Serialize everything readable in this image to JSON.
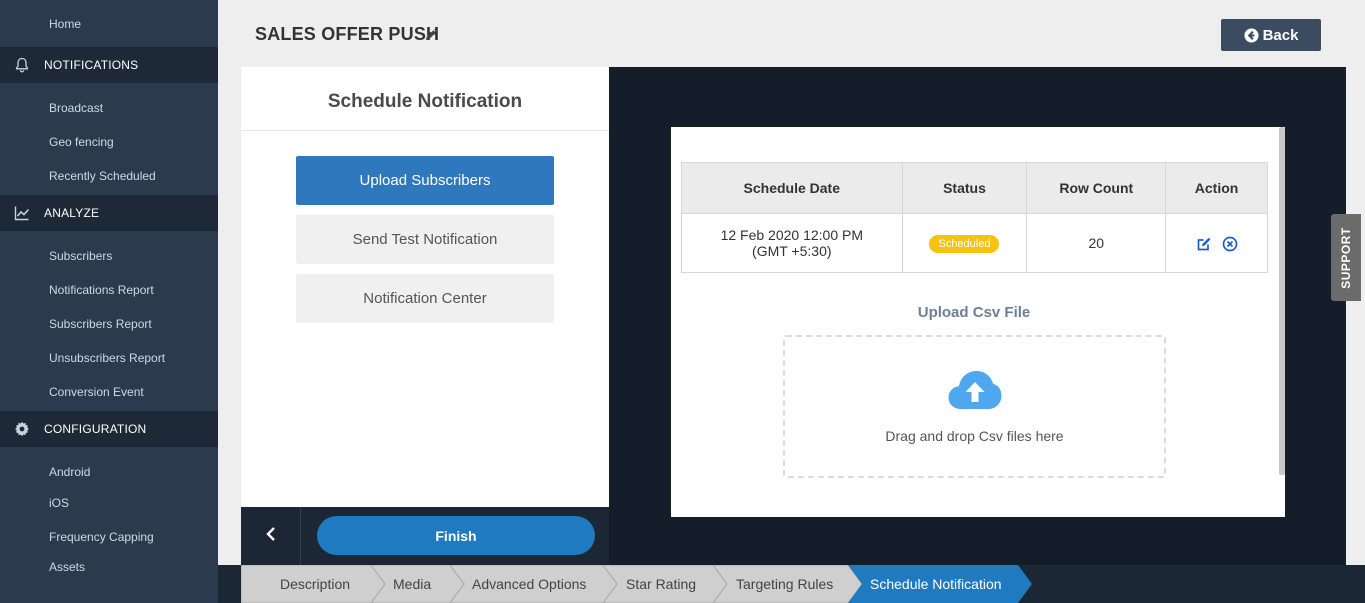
{
  "sidebar": {
    "top_item": "Home",
    "sections": [
      {
        "label": "NOTIFICATIONS",
        "icon": "bell-icon"
      },
      {
        "label": "ANALYZE",
        "icon": "line-chart-icon"
      },
      {
        "label": "CONFIGURATION",
        "icon": "gear-icon"
      }
    ],
    "notifications_items": [
      "Broadcast",
      "Geo fencing",
      "Recently Scheduled"
    ],
    "analyze_items": [
      "Subscribers",
      "Notifications Report",
      "Subscribers Report",
      "Unsubscribers Report",
      "Conversion Event"
    ],
    "configuration_items": [
      "Android",
      "iOS",
      "Frequency Capping",
      "Assets"
    ]
  },
  "header": {
    "title": "SALES OFFER PUSH",
    "back_label": "Back"
  },
  "left_panel": {
    "title": "Schedule Notification",
    "menu": [
      "Upload Subscribers",
      "Send Test Notification",
      "Notification Center"
    ],
    "finish_label": "Finish"
  },
  "table": {
    "headers": [
      "Schedule Date",
      "Status",
      "Row Count",
      "Action"
    ],
    "rows": [
      {
        "date_line1": "12 Feb 2020 12:00 PM",
        "date_line2": "(GMT +5:30)",
        "status": "Scheduled",
        "row_count": "20"
      }
    ]
  },
  "upload": {
    "label": "Upload Csv File",
    "drop_text": "Drag and drop Csv files here"
  },
  "support_label": "SUPPORT",
  "steps": [
    "Description",
    "Media",
    "Advanced Options",
    "Star Rating",
    "Targeting Rules",
    "Schedule Notification"
  ],
  "colors": {
    "sidebar_bg": "#2b3a4c",
    "section_bg": "#1e2937",
    "active_blue": "#2f78bd",
    "finish_blue": "#1f7ac0",
    "status_yellow": "#f5c311",
    "step_active": "#1f7ac0",
    "step_inactive": "#cfcfcf"
  }
}
